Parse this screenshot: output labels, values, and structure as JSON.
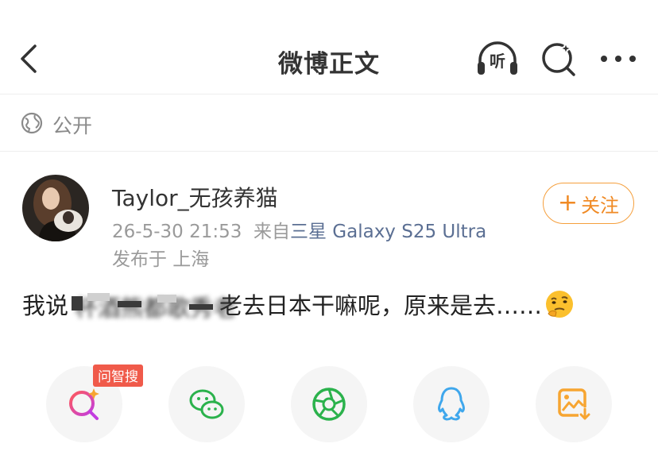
{
  "header": {
    "title": "微博正文",
    "listen_label": "听"
  },
  "visibility": {
    "label": "公开"
  },
  "author": {
    "name": "Taylor_无孩养猫",
    "time": "26-5-30 21:53",
    "source_prefix": "来自",
    "device": "三星 Galaxy S25 Ultra",
    "location": "发布于 上海",
    "follow_label": "关注"
  },
  "post": {
    "text_before": "我说",
    "text_hidden": "杯酒熊都歌秀老",
    "text_after": "老去日本干嘛呢，原来是去……"
  },
  "share_bar": {
    "badge": "问智搜",
    "items": [
      "ai-search",
      "wechat",
      "moments",
      "qq",
      "save-image"
    ]
  },
  "colors": {
    "accent": "#f08a24",
    "badge": "#f05a4a",
    "device_link": "#5b6f93",
    "wechat_green": "#2bb24c",
    "qq_blue": "#3fa7ec",
    "save_orange": "#f7a531"
  }
}
